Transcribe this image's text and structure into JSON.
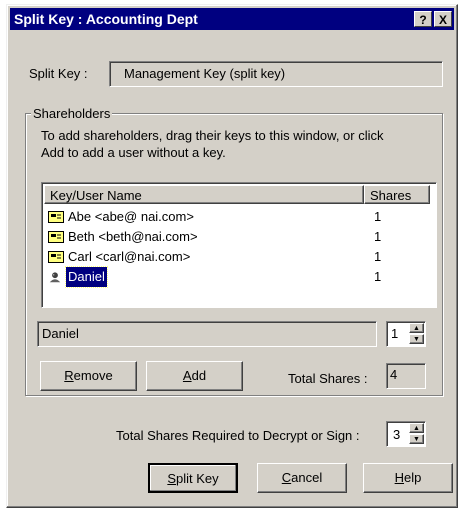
{
  "window": {
    "title": "Split Key : Accounting Dept",
    "help_btn": "?",
    "close_btn": "X"
  },
  "split_key": {
    "label": "Split Key :",
    "value": "Management Key (split key)"
  },
  "shareholders": {
    "group_label": "Shareholders",
    "instructions_line1": "To add shareholders, drag their keys to this window, or click",
    "instructions_line2": "Add to add a user without a key.",
    "columns": {
      "name": "Key/User Name",
      "shares": "Shares"
    },
    "rows": [
      {
        "name": "Abe <abe@ nai.com>",
        "shares": "1",
        "icon": "key-icon"
      },
      {
        "name": "Beth <beth@nai.com>",
        "shares": "1",
        "icon": "key-icon"
      },
      {
        "name": "Carl <carl@nai.com>",
        "shares": "1",
        "icon": "key-icon"
      },
      {
        "name": "Daniel",
        "shares": "1",
        "icon": "user-icon",
        "selected": true
      }
    ],
    "selected_name": "Daniel",
    "selected_shares": "1",
    "remove_label_u": "R",
    "remove_label_rest": "emove",
    "add_label_u": "A",
    "add_label_rest": "dd",
    "total_shares_label": "Total Shares :",
    "total_shares_value": "4"
  },
  "required": {
    "label": "Total Shares Required to Decrypt or Sign :",
    "value": "3"
  },
  "buttons": {
    "splitkey_u": "S",
    "splitkey_rest": "plit Key",
    "cancel_u": "C",
    "cancel_rest": "ancel",
    "help_u": "H",
    "help_rest": "elp"
  },
  "colors": {
    "dialog_bg": "#d4d0c8",
    "titlebar": "#000080",
    "selection": "#000080"
  }
}
